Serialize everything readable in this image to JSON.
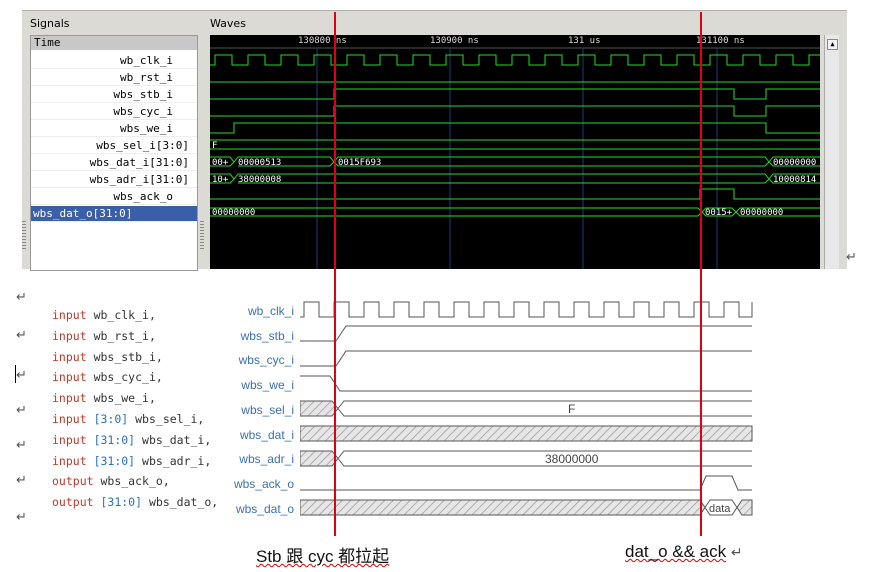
{
  "gtkwave": {
    "signals_label": "Signals",
    "waves_label": "Waves",
    "time_header": "Time",
    "signals": [
      "wb_clk_i",
      "wb_rst_i",
      "wbs_stb_i",
      "wbs_cyc_i",
      "wbs_we_i",
      "wbs_sel_i[3:0]",
      "wbs_dat_i[31:0]",
      "wbs_adr_i[31:0]",
      "wbs_ack_o",
      "wbs_dat_o[31:0]"
    ],
    "selected_signal": "wbs_dat_o[31:0]",
    "time_ticks": [
      "130800 ns",
      "130900 ns",
      "131 us",
      "131100 ns"
    ],
    "bus_values": {
      "sel": [
        "F"
      ],
      "dat_i": [
        "00+",
        "00000513",
        "0015F693",
        "00000000"
      ],
      "adr_i": [
        "10+",
        "38000008",
        "10000814"
      ],
      "dat_o": [
        "00000000",
        "0015+",
        "00000000"
      ]
    },
    "colors": {
      "wave": "#22dd22",
      "background": "#000000",
      "selected_row": "#3b5ea8"
    }
  },
  "code": {
    "lines": [
      {
        "kw": "input",
        "range": "",
        "name": "wb_clk_i,"
      },
      {
        "kw": "input",
        "range": "",
        "name": "wb_rst_i,"
      },
      {
        "kw": "input",
        "range": "",
        "name": "wbs_stb_i,"
      },
      {
        "kw": "input",
        "range": "",
        "name": "wbs_cyc_i,"
      },
      {
        "kw": "input",
        "range": "",
        "name": "wbs_we_i,"
      },
      {
        "kw": "input",
        "range": "[3:0]",
        "name": "wbs_sel_i,"
      },
      {
        "kw": "input",
        "range": "[31:0]",
        "name": "wbs_dat_i,"
      },
      {
        "kw": "input",
        "range": "[31:0]",
        "name": "wbs_adr_i,"
      },
      {
        "kw": "output",
        "range": "",
        "name": "wbs_ack_o,"
      },
      {
        "kw": "output",
        "range": "[31:0]",
        "name": "wbs_dat_o,"
      }
    ]
  },
  "timing": {
    "signals": [
      "wb_clk_i",
      "wbs_stb_i",
      "wbs_cyc_i",
      "wbs_we_i",
      "wbs_sel_i",
      "wbs_dat_i",
      "wbs_adr_i",
      "wbs_ack_o",
      "wbs_dat_o"
    ],
    "sel_value": "F",
    "adr_value": "38000000",
    "dat_o_value": "data"
  },
  "annotations": {
    "left": "Stb 跟 cyc 都拉起",
    "right": "dat_o && ack"
  },
  "return_symbol": "↵"
}
